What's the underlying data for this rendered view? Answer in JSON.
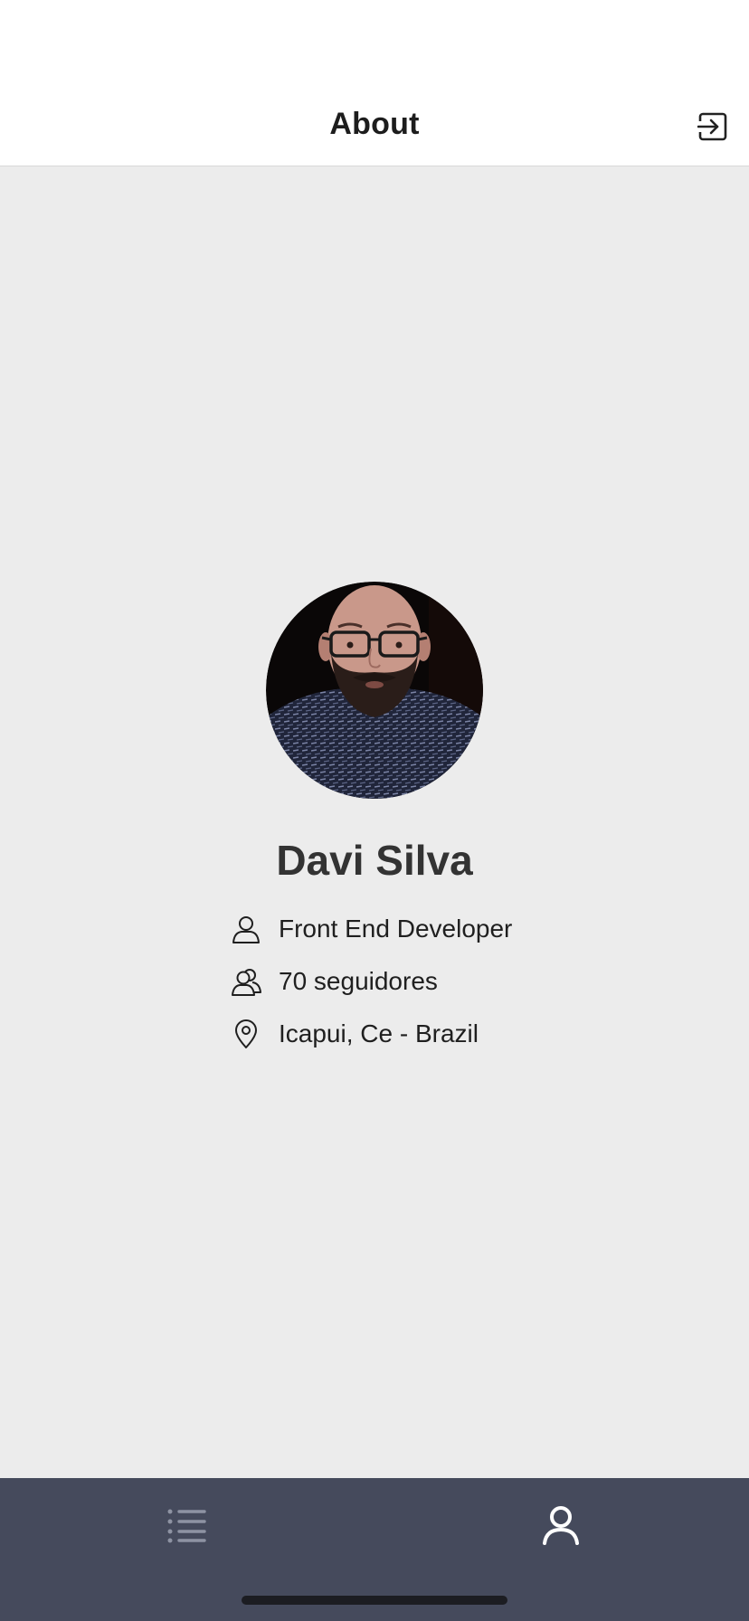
{
  "header": {
    "title": "About",
    "logout_icon": "logout-icon"
  },
  "profile": {
    "avatar_icon": "profile-photo",
    "name": "Davi Silva",
    "details": [
      {
        "icon": "user-icon",
        "text": "Front End Developer"
      },
      {
        "icon": "users-icon",
        "text": "70 seguidores"
      },
      {
        "icon": "map-pin-icon",
        "text": "Icapui, Ce - Brazil"
      }
    ]
  },
  "tab_bar": {
    "tabs": [
      {
        "icon": "list-icon",
        "active": false
      },
      {
        "icon": "user-icon",
        "active": true
      }
    ],
    "colors": {
      "background": "#454a5c",
      "active": "#ffffff",
      "inactive": "#8e93a3"
    }
  }
}
